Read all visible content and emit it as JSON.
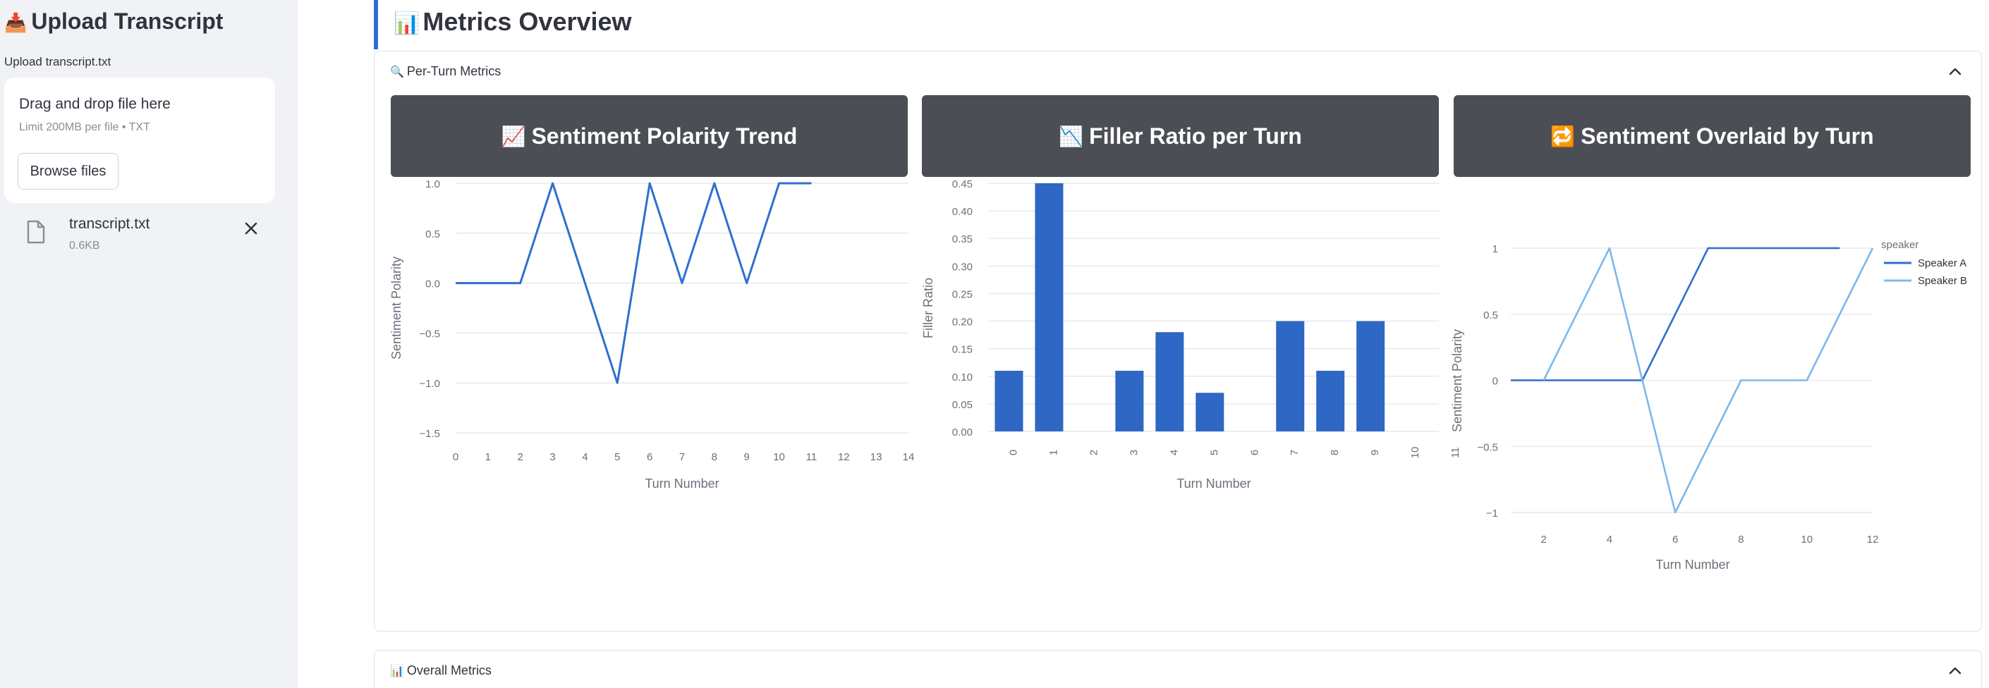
{
  "sidebar": {
    "title_emoji": "📥",
    "title": "Upload Transcript",
    "uploader_label": "Upload transcript.txt",
    "dropzone_title": "Drag and drop file here",
    "dropzone_limit": "Limit 200MB per file • TXT",
    "browse_label": "Browse files",
    "file": {
      "name": "transcript.txt",
      "size": "0.6KB"
    }
  },
  "main": {
    "title_emoji": "📊",
    "title": "Metrics Overview",
    "expanders": [
      {
        "emoji": "🔍",
        "label": "Per-Turn Metrics"
      },
      {
        "emoji": "📊",
        "label": "Overall Metrics"
      }
    ],
    "chart_headers": [
      {
        "emoji": "📈",
        "label": "Sentiment Polarity Trend"
      },
      {
        "emoji": "📉",
        "label": "Filler Ratio per Turn"
      },
      {
        "emoji": "🔁",
        "label": "Sentiment Overlaid by Turn"
      }
    ]
  },
  "colors": {
    "accent": "#2f6fce",
    "series_dark": "#2f6fce",
    "series_light": "#7cb8ee",
    "bar": "#2e67c4"
  },
  "chart_data": [
    {
      "type": "line",
      "x": [
        0,
        1,
        2,
        3,
        4,
        5,
        6,
        7,
        8,
        9,
        10,
        11
      ],
      "values": [
        0,
        0,
        0,
        1,
        0,
        -1,
        1,
        0,
        1,
        0,
        1,
        1
      ],
      "xlabel": "Turn Number",
      "ylabel": "Sentiment Polarity",
      "xlim": [
        0,
        14
      ],
      "ylim": [
        -1.5,
        1.0
      ],
      "xticks": [
        "0",
        "1",
        "2",
        "3",
        "4",
        "5",
        "6",
        "7",
        "8",
        "9",
        "10",
        "11",
        "12",
        "13",
        "14"
      ],
      "yticks": [
        "1.0",
        "0.5",
        "0.0",
        "−0.5",
        "−1.0",
        "−1.5"
      ],
      "grid": true
    },
    {
      "type": "bar",
      "categories": [
        "0",
        "1",
        "2",
        "3",
        "4",
        "5",
        "6",
        "7",
        "8",
        "9",
        "10",
        "11"
      ],
      "values": [
        0.11,
        0.45,
        0,
        0.11,
        0.18,
        0.07,
        0,
        0.2,
        0.11,
        0.2,
        0,
        0
      ],
      "xlabel": "Turn Number",
      "ylabel": "Filler Ratio",
      "ylim": [
        0,
        0.45
      ],
      "yticks": [
        "0.45",
        "0.40",
        "0.35",
        "0.30",
        "0.25",
        "0.20",
        "0.15",
        "0.10",
        "0.05",
        "0.00"
      ],
      "grid": true
    },
    {
      "type": "line",
      "series": [
        {
          "name": "Speaker A",
          "x": [
            1,
            2,
            3,
            4,
            5,
            6,
            7,
            8,
            9,
            10,
            11
          ],
          "values": [
            0,
            0,
            0,
            0,
            0,
            0.5,
            1,
            1,
            1,
            1,
            1
          ]
        },
        {
          "name": "Speaker B",
          "x": [
            2,
            4,
            5,
            6,
            7,
            8,
            9,
            10,
            11,
            12
          ],
          "values": [
            0,
            1,
            0,
            -1,
            -0.5,
            0,
            0,
            0,
            0.5,
            1
          ]
        }
      ],
      "xlabel": "Turn Number",
      "ylabel": "Sentiment Polarity",
      "xlim": [
        1,
        12
      ],
      "ylim": [
        -1,
        1
      ],
      "xticks": [
        "2",
        "4",
        "6",
        "8",
        "10",
        "12"
      ],
      "yticks": [
        "1",
        "0.5",
        "0",
        "−0.5",
        "−1"
      ],
      "legend_title": "speaker",
      "legend": "top-right",
      "grid": true
    }
  ]
}
